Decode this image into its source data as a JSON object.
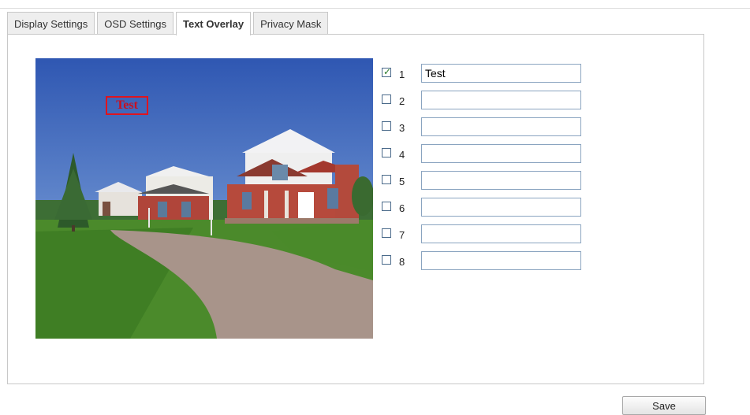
{
  "tabs": [
    {
      "label": "Display Settings",
      "active": false
    },
    {
      "label": "OSD Settings",
      "active": false
    },
    {
      "label": "Text Overlay",
      "active": true
    },
    {
      "label": "Privacy Mask",
      "active": false
    }
  ],
  "preview": {
    "overlay_text": "Test",
    "overlay_color": "#e0141e"
  },
  "overlays": [
    {
      "number": "1",
      "checked": true,
      "value": "Test"
    },
    {
      "number": "2",
      "checked": false,
      "value": ""
    },
    {
      "number": "3",
      "checked": false,
      "value": ""
    },
    {
      "number": "4",
      "checked": false,
      "value": ""
    },
    {
      "number": "5",
      "checked": false,
      "value": ""
    },
    {
      "number": "6",
      "checked": false,
      "value": ""
    },
    {
      "number": "7",
      "checked": false,
      "value": ""
    },
    {
      "number": "8",
      "checked": false,
      "value": ""
    }
  ],
  "actions": {
    "save_label": "Save"
  }
}
